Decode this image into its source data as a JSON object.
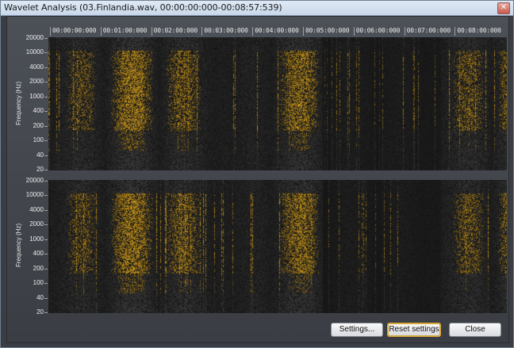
{
  "window": {
    "title": "Wavelet Analysis (03.Finlandia.wav, 00:00:00:000-00:08:57:539)",
    "close_glyph": "✕"
  },
  "timeline": {
    "labels": [
      "00:00:00:000",
      "00:01:00:000",
      "00:02:00:000",
      "00:03:00:000",
      "00:04:00:000",
      "00:05:00:000",
      "00:06:00:000",
      "00:07:00:000",
      "00:08:00:000"
    ]
  },
  "top_panel": {
    "ylabel": "Frequency (Hz)",
    "yticks": [
      "20000",
      "10000",
      "4000",
      "2000",
      "1000",
      "400",
      "200",
      "100",
      "40",
      "20"
    ]
  },
  "bottom_panel": {
    "ylabel": "Frequency (Hz)",
    "yticks": [
      "20000",
      "10000",
      "4000",
      "2000",
      "1000",
      "400",
      "200",
      "100",
      "40",
      "20"
    ]
  },
  "colors": {
    "spectrogram_high": "#e1a832",
    "spectrogram_low": "#1b1b1b"
  },
  "buttons": {
    "settings": "Settings...",
    "reset": "Reset settings",
    "close": "Close"
  }
}
